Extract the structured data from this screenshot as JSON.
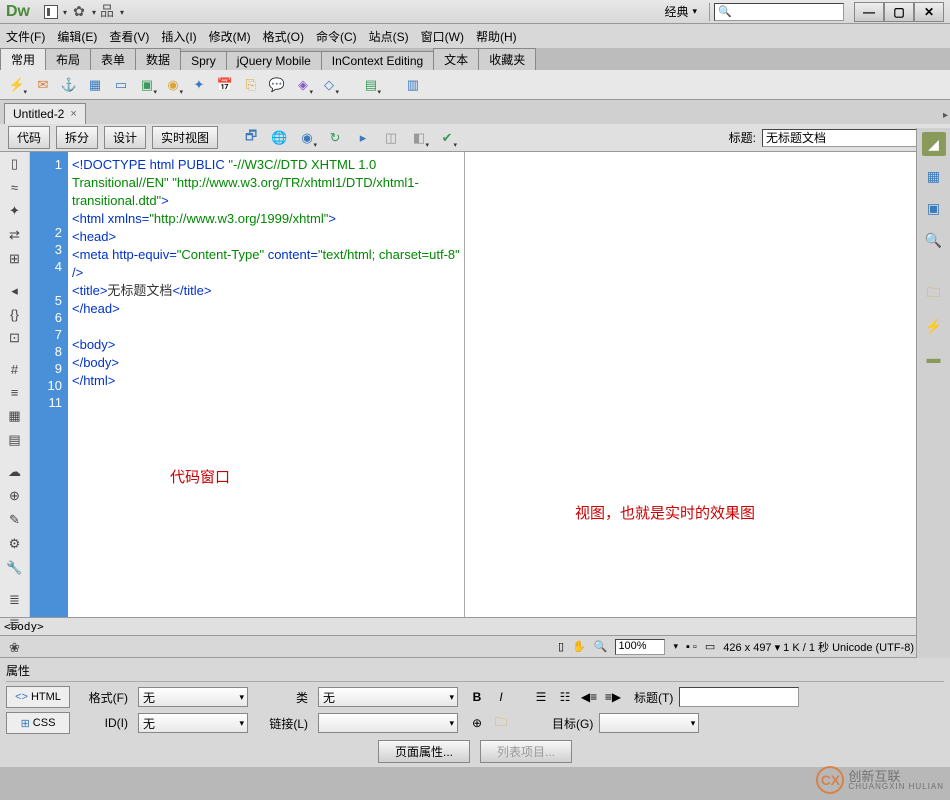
{
  "app": {
    "logo": "Dw"
  },
  "workspace": {
    "label": "经典"
  },
  "win": {
    "min": "—",
    "max": "▢",
    "close": "✕"
  },
  "menu": [
    "文件(F)",
    "编辑(E)",
    "查看(V)",
    "插入(I)",
    "修改(M)",
    "格式(O)",
    "命令(C)",
    "站点(S)",
    "窗口(W)",
    "帮助(H)"
  ],
  "insert_tabs": [
    "常用",
    "布局",
    "表单",
    "数据",
    "Spry",
    "jQuery Mobile",
    "InContext Editing",
    "文本",
    "收藏夹"
  ],
  "insert_active": 0,
  "doc_tab": {
    "name": "Untitled-2",
    "close": "×"
  },
  "view_buttons": [
    "代码",
    "拆分",
    "设计",
    "实时视图"
  ],
  "title_field": {
    "label": "标题:",
    "value": "无标题文档"
  },
  "code_lines": {
    "count": 11
  },
  "code": {
    "l1a": "<!DOCTYPE html PUBLIC ",
    "l1b": "\"-//W3C//DTD XHTML 1.0 Transitional//EN\"",
    "l1c": " ",
    "l1d": "\"http://www.w3.org/TR/xhtml1/DTD/xhtml1-transitional.dtd\"",
    "l1e": ">",
    "l2a": "<html xmlns=",
    "l2b": "\"http://www.w3.org/1999/xhtml\"",
    "l2c": ">",
    "l3": "<head>",
    "l4a": "<meta http-equiv=",
    "l4b": "\"Content-Type\"",
    "l4c": " content=",
    "l4d": "\"text/html; charset=utf-8\"",
    "l4e": " />",
    "l5a": "<title>",
    "l5b": "无标题文档",
    "l5c": "</title>",
    "l6": "</head>",
    "l7": "",
    "l8": "<body>",
    "l9": "</body>",
    "l10": "</html>"
  },
  "labels": {
    "code_pane": "代码窗口",
    "design_pane": "视图，也就是实时的效果图"
  },
  "tag_selector": "<body>",
  "status": {
    "zoom": "100%",
    "size": "426 x 497 ▾ 1 K / 1 秒 Unicode (UTF-8)"
  },
  "properties": {
    "title": "属性",
    "html_btn": "HTML",
    "css_btn": "CSS",
    "format_label": "格式(F)",
    "format_value": "无",
    "class_label": "类",
    "class_value": "无",
    "id_label": "ID(I)",
    "id_value": "无",
    "link_label": "链接(L)",
    "title_label": "标题(T)",
    "target_label": "目标(G)",
    "page_props": "页面属性...",
    "list_items": "列表项目..."
  },
  "watermark": {
    "logo": "CX",
    "name": "创新互联",
    "sub": "CHUANGXIN HULIAN"
  }
}
